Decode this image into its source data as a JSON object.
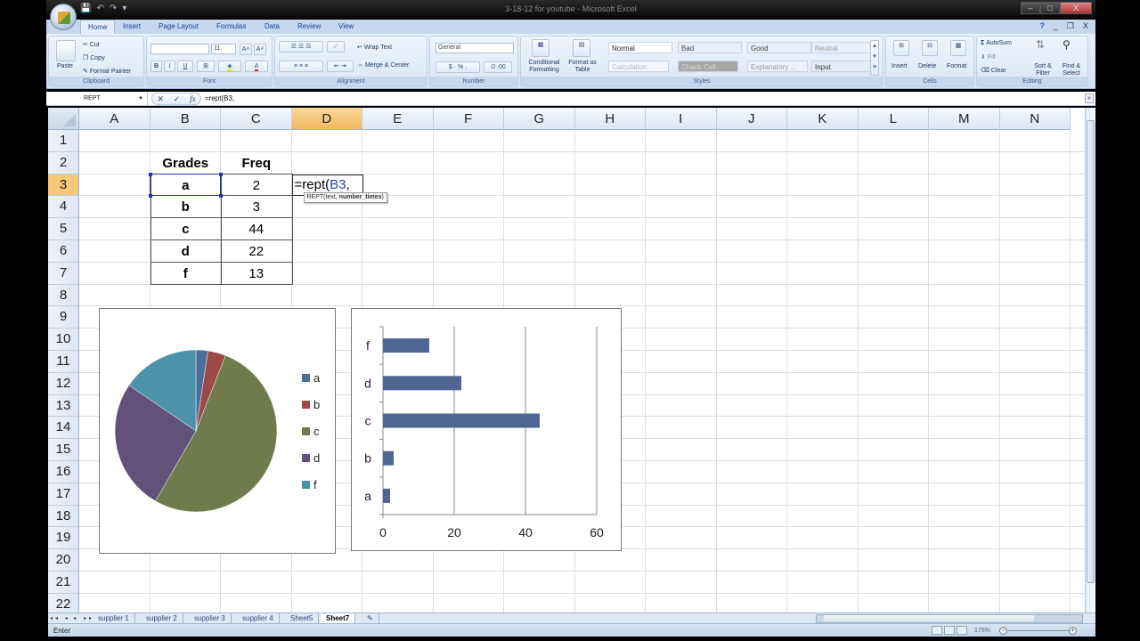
{
  "window": {
    "title": "3-18-12 for youtube - Microsoft Excel",
    "controls": {
      "minimize": "–",
      "maximize": "□",
      "close": "X"
    }
  },
  "quick_access": {
    "save": "💾",
    "undo": "↶",
    "redo": "↷",
    "customize": "▾"
  },
  "ribbon": {
    "tabs": [
      "Home",
      "Insert",
      "Page Layout",
      "Formulas",
      "Data",
      "Review",
      "View"
    ],
    "active_tab": "Home",
    "mdi": {
      "help": "?",
      "min": "_",
      "restore": "❐",
      "close": "X"
    },
    "clipboard": {
      "label": "Clipboard",
      "paste": "Paste",
      "cut": "Cut",
      "copy": "Copy",
      "format_painter": "Format Painter"
    },
    "font": {
      "label": "Font",
      "font_name": "",
      "font_size": "11",
      "bold": "B",
      "italic": "I",
      "underline": "U",
      "grow": "A˄",
      "shrink": "A˅"
    },
    "alignment": {
      "label": "Alignment",
      "wrap_text": "Wrap Text",
      "merge_center": "Merge & Center"
    },
    "number": {
      "label": "Number",
      "format": "General",
      "currency": "$",
      "percent": "%",
      "comma": ","
    },
    "styles": {
      "label": "Styles",
      "conditional_formatting": "Conditional Formatting",
      "format_as_table": "Format as Table",
      "cells": [
        {
          "name": "Normal",
          "bg": "#ffffff",
          "color": "#222222"
        },
        {
          "name": "Bad",
          "bg": "#e9eff8",
          "color": "#444444"
        },
        {
          "name": "Good",
          "bg": "#e9eff8",
          "color": "#444444"
        },
        {
          "name": "Neutral",
          "bg": "#e9eff8",
          "color": "#999999"
        },
        {
          "name": "Calculation",
          "bg": "#f4f6fa",
          "color": "#b0b8c8"
        },
        {
          "name": "Check Cell",
          "bg": "#a7a7a7",
          "color": "#d8d8d8"
        },
        {
          "name": "Explanatory ...",
          "bg": "#eef3fa",
          "color": "#999999"
        },
        {
          "name": "Input",
          "bg": "#e4ebf5",
          "color": "#333333"
        }
      ]
    },
    "cells": {
      "label": "Cells",
      "insert": "Insert",
      "delete": "Delete",
      "format": "Format"
    },
    "editing": {
      "label": "Editing",
      "autosum": "AutoSum",
      "fill": "Fill",
      "clear": "Clear",
      "sort_filter": "Sort & Filter",
      "find_select": "Find & Select"
    }
  },
  "formula_bar": {
    "name_box": "REPT",
    "cancel": "✕",
    "enter": "✓",
    "fx": "fx",
    "formula": "=rept(B3,"
  },
  "grid": {
    "columns": [
      "A",
      "B",
      "C",
      "D",
      "E",
      "F",
      "G",
      "H",
      "I",
      "J",
      "K",
      "L",
      "M",
      "N"
    ],
    "selected_column": "D",
    "rows": [
      "1",
      "2",
      "3",
      "4",
      "5",
      "6",
      "7",
      "8",
      "9",
      "10",
      "11",
      "12",
      "13",
      "14",
      "15",
      "16",
      "17",
      "18",
      "19",
      "20",
      "21",
      "22"
    ],
    "selected_row": "3",
    "table": {
      "headers": [
        "Grades",
        "Freq"
      ],
      "rows": [
        [
          "a",
          "2"
        ],
        [
          "b",
          "3"
        ],
        [
          "c",
          "44"
        ],
        [
          "d",
          "22"
        ],
        [
          "f",
          "13"
        ]
      ]
    },
    "active_cell": {
      "address": "D3",
      "prefix": "=rept(",
      "ref": "B3",
      "suffix": ","
    },
    "tooltip": {
      "func": "REPT(text, ",
      "arg": "number_times",
      "close": ")"
    }
  },
  "chart_data": [
    {
      "type": "pie",
      "title": "",
      "categories": [
        "a",
        "b",
        "c",
        "d",
        "f"
      ],
      "values": [
        2,
        3,
        44,
        22,
        13
      ],
      "colors": [
        "#4f6d9a",
        "#9c4a48",
        "#6f7b4c",
        "#62527a",
        "#4d93a8"
      ],
      "legend": "right"
    },
    {
      "type": "bar",
      "orientation": "horizontal",
      "title": "",
      "categories": [
        "a",
        "b",
        "c",
        "d",
        "f"
      ],
      "values": [
        2,
        3,
        44,
        22,
        13
      ],
      "xlim": [
        0,
        60
      ],
      "xticks": [
        "0",
        "20",
        "40",
        "60"
      ],
      "grid": true,
      "color": "#4f6692",
      "legend": "none"
    }
  ],
  "sheets": {
    "nav": "◂◂ ◂ ▸ ▸▸",
    "tabs": [
      "supplier 1",
      "supplier 2",
      "supplier 3",
      "supplier 4",
      "Sheet5",
      "Sheet7"
    ],
    "active": "Sheet7",
    "new_sheet": "✎"
  },
  "status": {
    "mode": "Enter",
    "zoom": "175%",
    "zoom_fraction": 0.5
  }
}
